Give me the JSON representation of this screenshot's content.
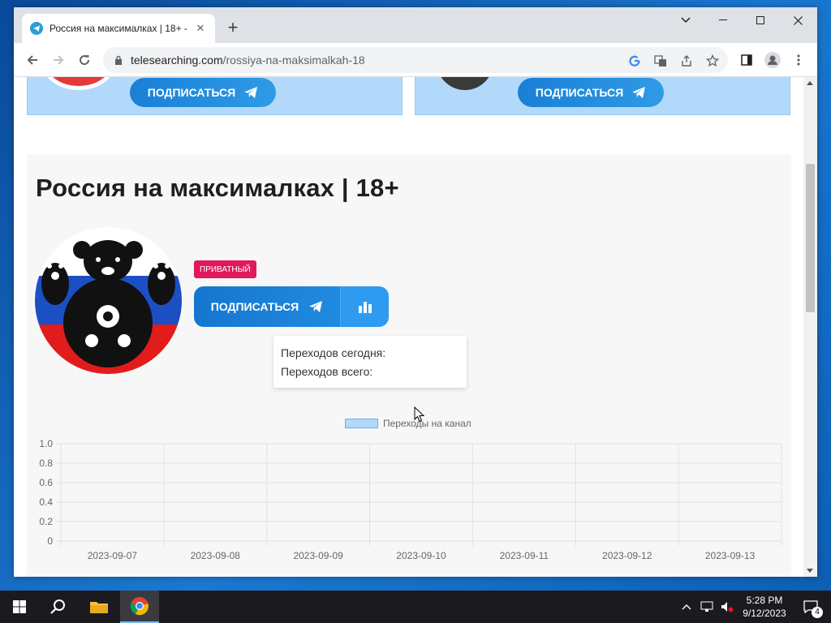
{
  "browser": {
    "tab_title": "Россия на максималках | 18+ - …",
    "url_host": "telesearching.com",
    "url_path": "/rossiya-na-maksimalkah-18"
  },
  "page": {
    "top_cards": [
      {
        "subscribe_label": "ПОДПИСАТЬСЯ"
      },
      {
        "subscribe_label": "ПОДПИСАТЬСЯ"
      }
    ],
    "channel_title": "Россия на максималках | 18+",
    "badge": "ПРИВАТНЫЙ",
    "subscribe_label": "ПОДПИСАТЬСЯ",
    "stats": {
      "today_label": "Переходов сегодня:",
      "total_label": "Переходов всего:"
    }
  },
  "chart_data": {
    "type": "bar",
    "legend": [
      "Переходы на канал"
    ],
    "categories": [
      "2023-09-07",
      "2023-09-08",
      "2023-09-09",
      "2023-09-10",
      "2023-09-11",
      "2023-09-12",
      "2023-09-13"
    ],
    "series": [
      {
        "name": "Переходы на канал",
        "values": [
          0,
          0,
          0,
          0,
          0,
          0,
          0
        ]
      }
    ],
    "yticks": [
      "0",
      "0.2",
      "0.4",
      "0.6",
      "0.8",
      "1.0"
    ],
    "ylim": [
      0,
      1
    ],
    "grid": true,
    "legend_position": "top",
    "colors": {
      "fill": "#b3d9fa",
      "border": "#6ab0e8"
    }
  },
  "taskbar": {
    "time": "5:28 PM",
    "date": "9/12/2023",
    "notification_count": "4"
  },
  "colors": {
    "accent": "#1a7fd6",
    "badge": "#e0195a",
    "card_bg": "#b3d9fa"
  }
}
